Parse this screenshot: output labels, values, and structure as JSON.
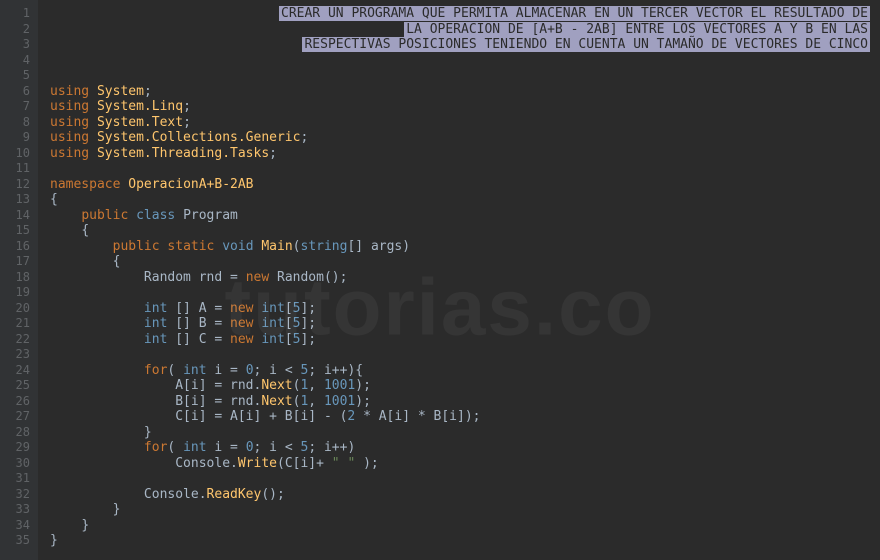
{
  "watermark": "tutorias.co",
  "lineNumbers": [
    "1",
    "2",
    "3",
    "4",
    "5",
    "6",
    "7",
    "8",
    "9",
    "10",
    "11",
    "12",
    "13",
    "14",
    "15",
    "16",
    "17",
    "18",
    "19",
    "20",
    "21",
    "22",
    "23",
    "24",
    "25",
    "26",
    "27",
    "28",
    "29",
    "30",
    "31",
    "32",
    "33",
    "34",
    "35"
  ],
  "comments": {
    "l1": "CREAR UN PROGRAMA QUE PERMITA ALMACENAR EN UN TERCER VECTOR EL RESULTADO DE",
    "l2": "LA OPERACION DE [A+B - 2AB] ENTRE LOS VECTORES A Y B EN LAS",
    "l3": "RESPECTIVAS POSICIONES TENIENDO EN CUENTA UN TAMAÑO DE VECTORES DE CINCO"
  },
  "code": {
    "using": "using",
    "namespace_kw": "namespace",
    "public_kw": "public",
    "class_kw": "class",
    "static_kw": "static",
    "void_kw": "void",
    "new_kw": "new",
    "for_kw": "for",
    "int_kw": "int",
    "string_kw": "string",
    "ns_system": "System",
    "ns_linq": "System.Linq",
    "ns_text": "System.Text",
    "ns_generic": "System.Collections.Generic",
    "ns_tasks": "System.Threading.Tasks",
    "ns_name": "OperacionA+B-2AB",
    "cls_name": "Program",
    "main_fn": "Main",
    "args": "args",
    "random": "Random",
    "rnd": "rnd",
    "next": "Next",
    "console": "Console",
    "write": "Write",
    "readkey": "ReadKey",
    "arr_a": "A",
    "arr_b": "B",
    "arr_c": "C",
    "var_i": "i",
    "n5": "5",
    "n0": "0",
    "n1": "1",
    "n2": "2",
    "n1001": "1001",
    "str_space": "\" \""
  }
}
